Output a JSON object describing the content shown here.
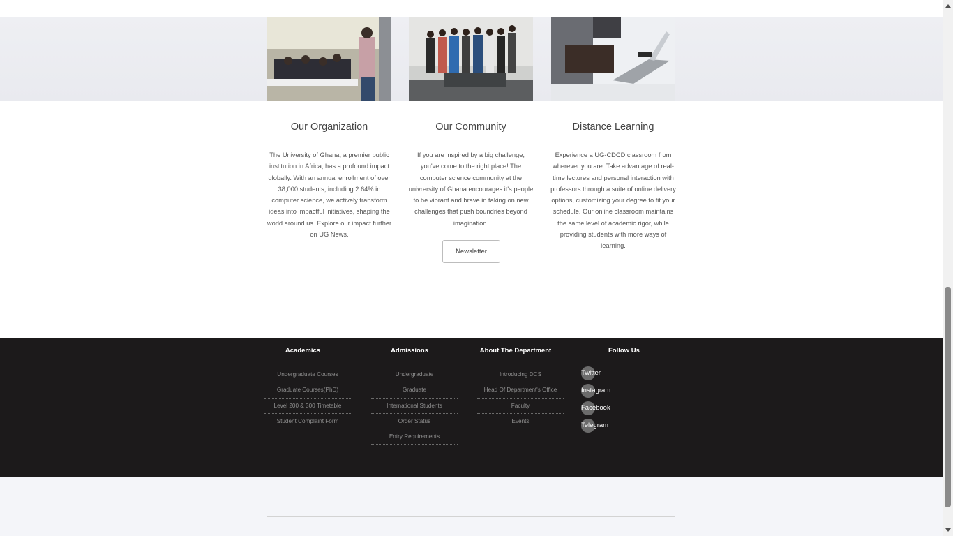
{
  "features": [
    {
      "title": "Our Organization",
      "text": "The University of Ghana, a premier public institution in Africa, has a profound impact globally. With an annual enrollment of over 38,000 students, including 2.64% in computer science, we actively transform ideas into impactful initiatives, shaping the world around us. Explore our impact further on UG News."
    },
    {
      "title": "Our Community",
      "text": "If you are inspired by a big challenge, you've come to the right place! The computer science community at the univrersity of Ghana encourages it's people to be vibrant and brave in taking on new challenges that push boundries beyond imagination."
    },
    {
      "title": "Distance Learning",
      "text": "Experience a UG-CDCD classroom from wherever you are. Take advantage of real-time lectures and personal interaction with professors through a suite of online delivery options, customizing your degree to fit your schedule. Our online classroom maintains the same level of academic rigor, while providing students with more ways of learning."
    }
  ],
  "newsletter_label": "Newsletter",
  "footer": {
    "academics": {
      "heading": "Academics",
      "links": [
        "Undergraduate Courses",
        "Graduate Courses(PhD)",
        "Level 200 & 300 Timetable",
        "Student Complaint Form"
      ]
    },
    "admissions": {
      "heading": "Admissions",
      "links": [
        "Undergraduate",
        "Graduate",
        "International Students",
        "Order Status",
        "Entry Requirements"
      ]
    },
    "about": {
      "heading": "About The Department",
      "links": [
        "Introducing DCS",
        "Head Of Department's Office",
        "Faculty",
        "Events"
      ]
    },
    "follow": {
      "heading": "Follow Us",
      "links": [
        "Twitter",
        "Instagram",
        "Facebook",
        "Telegram"
      ]
    }
  },
  "colors": {
    "footer_bg": "#1c1a1b",
    "heading_text": "#444444",
    "body_text": "#555555",
    "footer_link": "#8f8f8f"
  }
}
